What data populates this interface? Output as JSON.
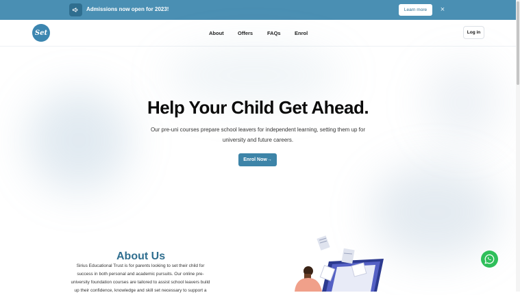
{
  "banner": {
    "message": "Admissions now open for 2023!",
    "learn_more": "Learn more",
    "close_icon": "×"
  },
  "header": {
    "logo_text": "Set",
    "nav": [
      "About",
      "Offers",
      "FAQs",
      "Enrol"
    ],
    "login": "Log in"
  },
  "hero": {
    "title": "Help Your Child Get Ahead.",
    "subtitle_line1": "Our pre-uni courses prepare school leavers for independent learning, setting them up for",
    "subtitle_line2": "university and future careers.",
    "cta": "Enrol Now",
    "cta_arrow": "→"
  },
  "about": {
    "title": "About Us",
    "lines": [
      "Sirius Educational Trust is for parents looking to set their child for",
      "success in both personal and academic pursuits. Our online pre-",
      "university foundation courses are tailored to assist school leavers build",
      "up their confidence, knowledge and skill set necessary to support a"
    ]
  },
  "colors": {
    "brand": "#4a8fb3",
    "brand_dark": "#2f6e8f",
    "cta": "#3d84a8",
    "whatsapp": "#2fbf5a"
  },
  "icons": {
    "megaphone": "megaphone-icon",
    "close": "close-icon",
    "whatsapp": "whatsapp-icon",
    "arrow": "arrow-right-icon"
  }
}
